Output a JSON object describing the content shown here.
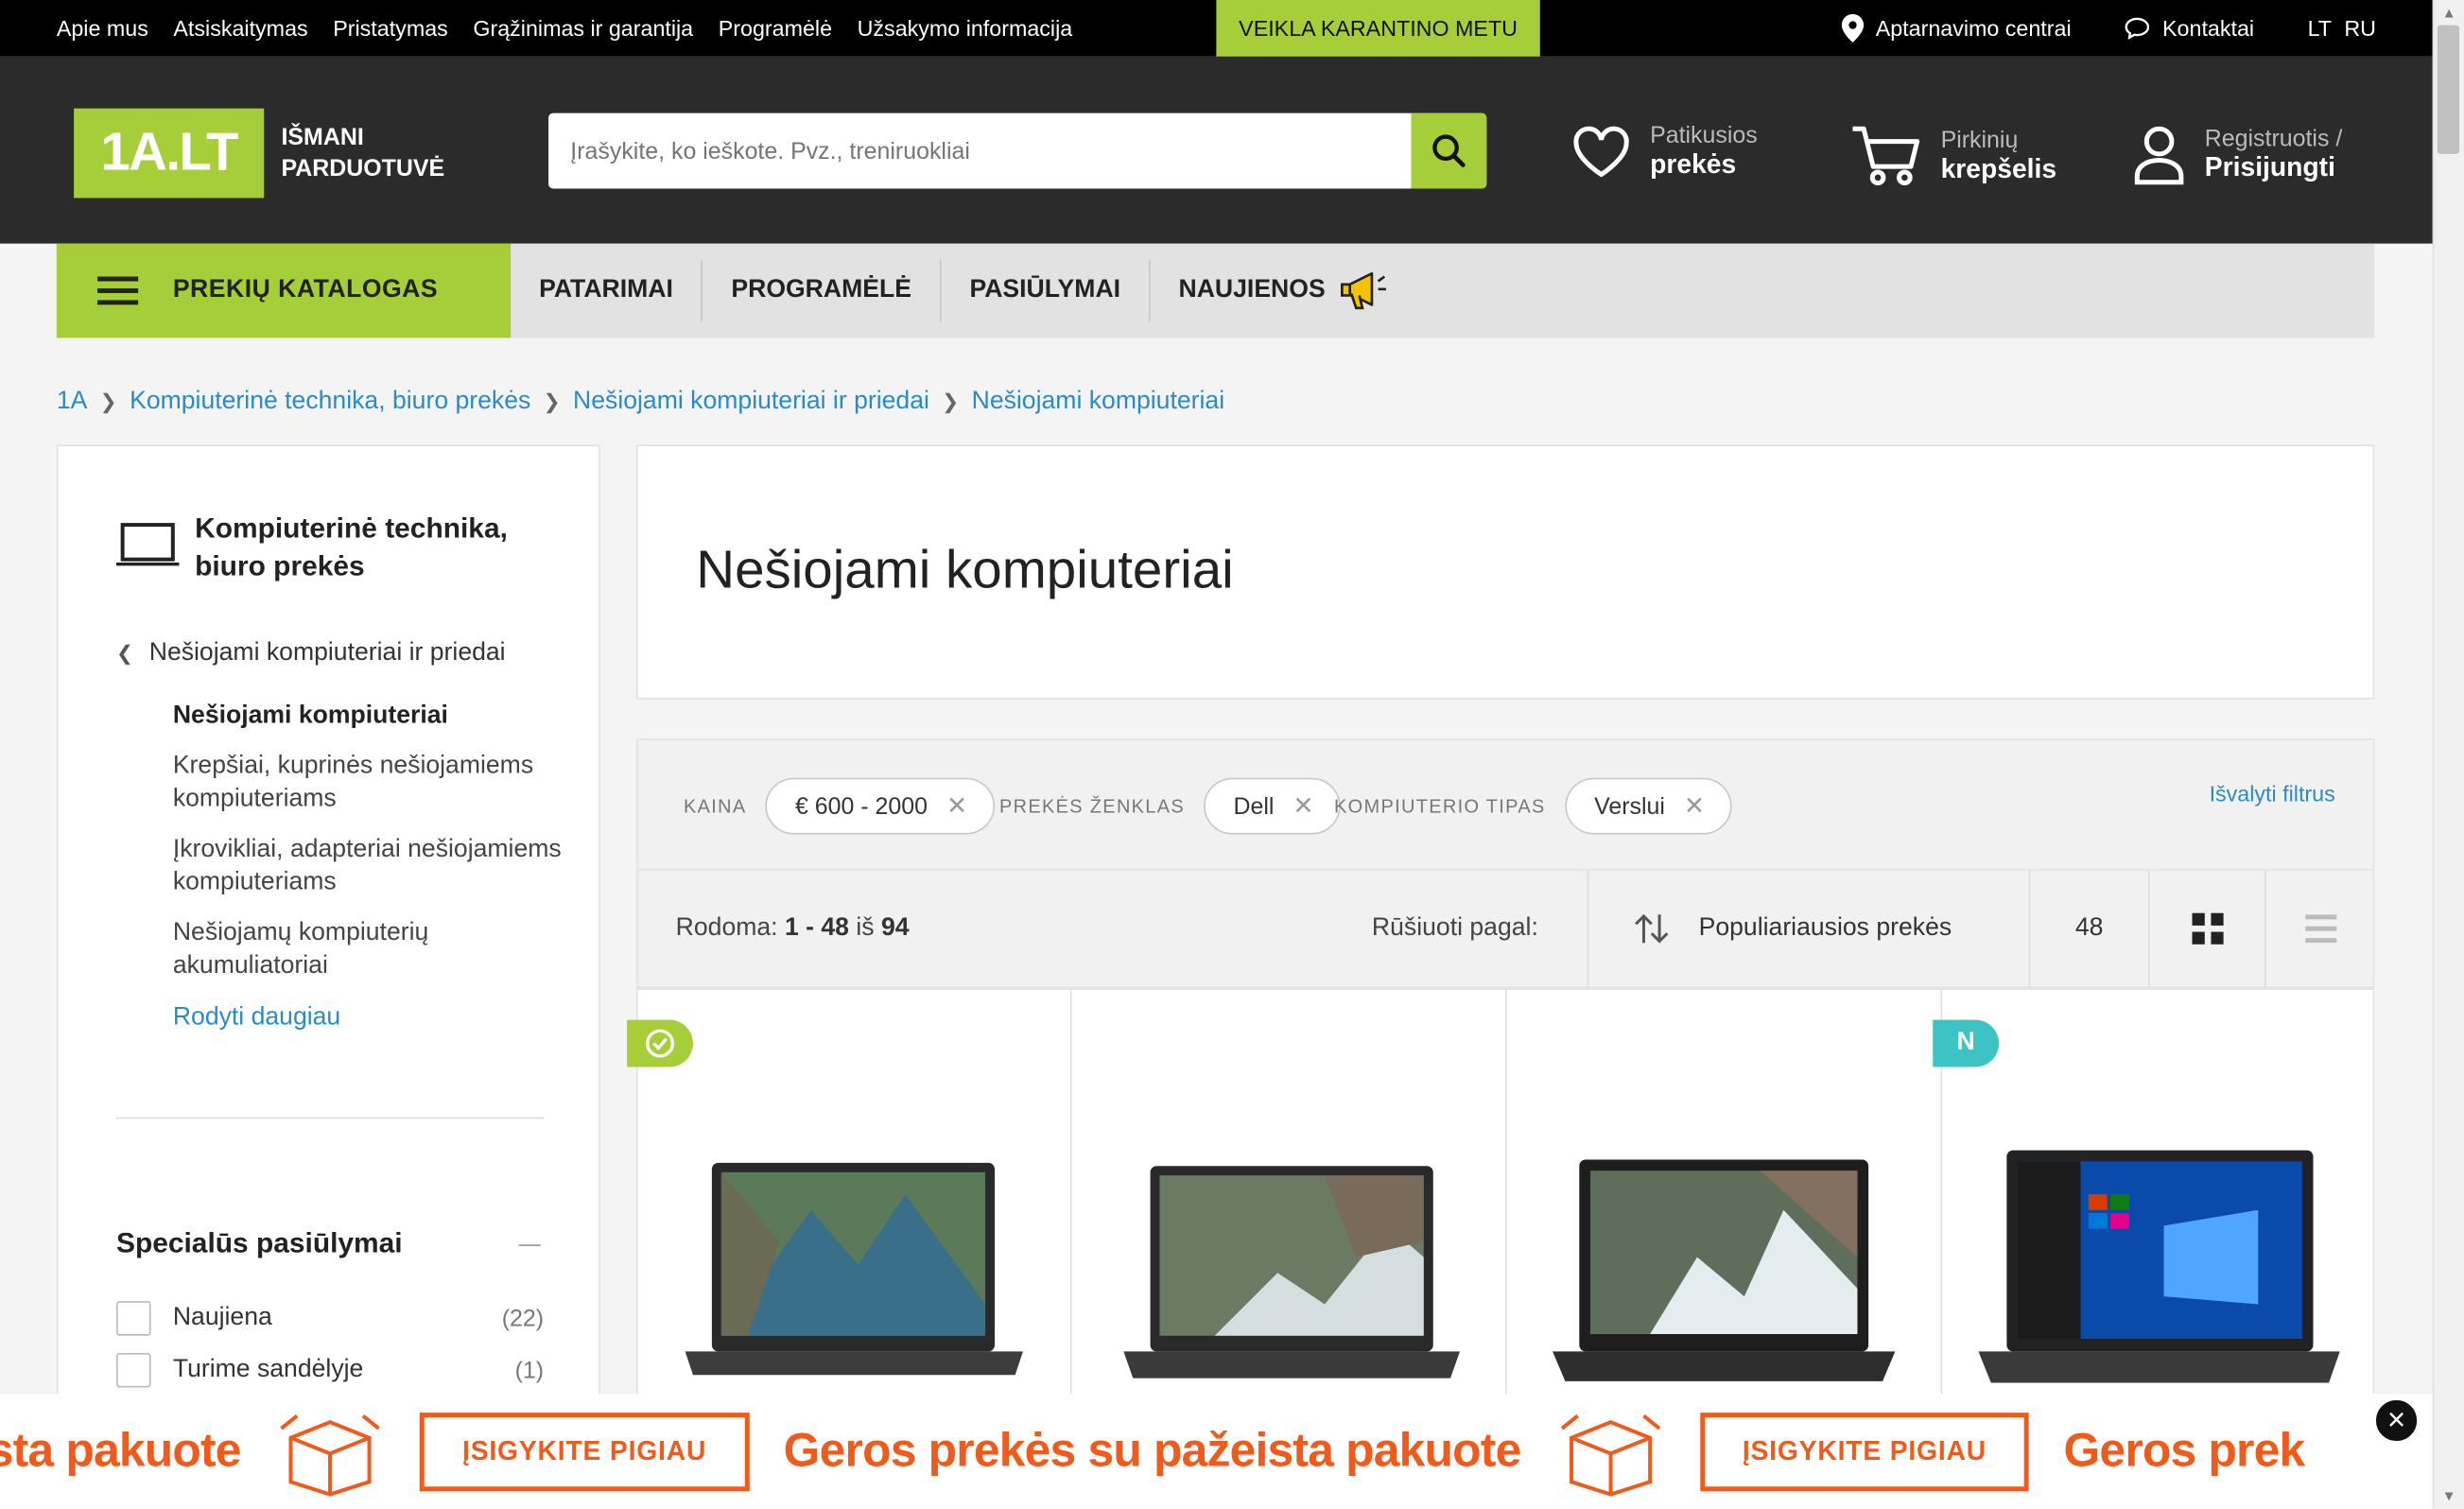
{
  "topbar": {
    "links": [
      "Apie mus",
      "Atsiskaitymas",
      "Pristatymas",
      "Grąžinimas ir garantija",
      "Programėlė",
      "Užsakymo informacija"
    ],
    "quarantine": "VEIKLA KARANTINO METU",
    "service_centers": "Aptarnavimo centrai",
    "contacts": "Kontaktai",
    "lang_lt": "LT",
    "lang_ru": "RU"
  },
  "header": {
    "logo": "1A.LT",
    "tagline_1": "IŠMANI",
    "tagline_2": "PARDUOTUVĖ",
    "search_placeholder": "Įrašykite, ko ieškote. Pvz., treniruokliai",
    "favorites_small": "Patikusios",
    "favorites_big": "prekės",
    "cart_small": "Pirkinių",
    "cart_big": "krepšelis",
    "account_small": "Registruotis /",
    "account_big": "Prisijungti"
  },
  "nav": {
    "catalog": "PREKIŲ KATALOGAS",
    "items": [
      "PATARIMAI",
      "PROGRAMĖLĖ",
      "PASIŪLYMAI",
      "NAUJIENOS"
    ]
  },
  "breadcrumb": [
    "1A",
    "Kompiuterinė technika, biuro prekės",
    "Nešiojami kompiuteriai ir priedai",
    "Nešiojami kompiuteriai"
  ],
  "sidebar": {
    "category_title_1": "Kompiuterinė technika,",
    "category_title_2": "biuro prekės",
    "back": "Nešiojami kompiuteriai ir priedai",
    "items": [
      "Nešiojami kompiuteriai",
      "Krepšiai, kuprinės nešiojamiems kompiuteriams",
      "Įkrovikliai, adapteriai nešiojamiems kompiuteriams",
      "Nešiojamų kompiuterių akumuliatoriai"
    ],
    "show_more": "Rodyti daugiau",
    "special_title": "Specialūs pasiūlymai",
    "checkboxes": [
      {
        "label": "Naujiena",
        "count": "(22)"
      },
      {
        "label": "Turime sandėlyje",
        "count": "(1)"
      }
    ]
  },
  "main": {
    "title": "Nešiojami kompiuteriai",
    "filters": [
      {
        "label": "KAINA",
        "value": "€ 600 - 2000"
      },
      {
        "label": "PREKĖS ŽENKLAS",
        "value": "Dell"
      },
      {
        "label": "KOMPIUTERIO TIPAS",
        "value": "Verslui"
      }
    ],
    "clear_filters": "Išvalyti filtrus",
    "showing_prefix": "Rodoma:",
    "showing_range": "1 - 48",
    "showing_of": "iš",
    "showing_total": "94",
    "sort_label": "Rūšiuoti pagal:",
    "sort_value": "Populiariausios prekės",
    "per_page": "48",
    "badge_new": "N"
  },
  "promo": {
    "text_1": "eista pakuote",
    "button": "ĮSIGYKITE PIGIAU",
    "text_2": "Geros prekės su pažeista pakuote",
    "text_3": "Geros prek",
    "close": "×"
  },
  "colors": {
    "brand_green": "#a6ce39",
    "link_blue": "#2a8bc8",
    "promo_orange": "#f05a1a",
    "badge_teal": "#3dc3c3"
  }
}
